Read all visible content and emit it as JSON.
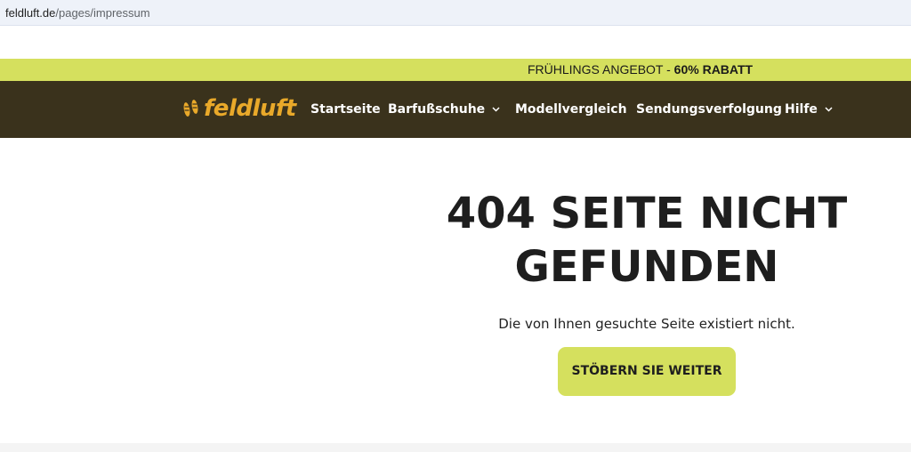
{
  "browser": {
    "url_domain": "feldluft.de",
    "url_path": "/pages/impressum"
  },
  "promo": {
    "text": "FRÜHLINGS ANGEBOT - ",
    "highlight": "60% RABATT",
    "color": "#d5e05e"
  },
  "header": {
    "logo_text": "feldluft",
    "logo_icon": "footprints-icon",
    "brand_color": "#e9a92a",
    "background": "#3a321c",
    "nav": {
      "home": "Startseite",
      "shoes": "Barfußschuhe",
      "compare": "Modellvergleich",
      "tracking": "Sendungsverfolgung",
      "help": "Hilfe"
    }
  },
  "main": {
    "title": "404 SEITE NICHT GEFUNDEN",
    "subtitle": "Die von Ihnen gesuchte Seite existiert nicht.",
    "cta_label": "STÖBERN SIE WEITER",
    "cta_color": "#d5e05e"
  }
}
